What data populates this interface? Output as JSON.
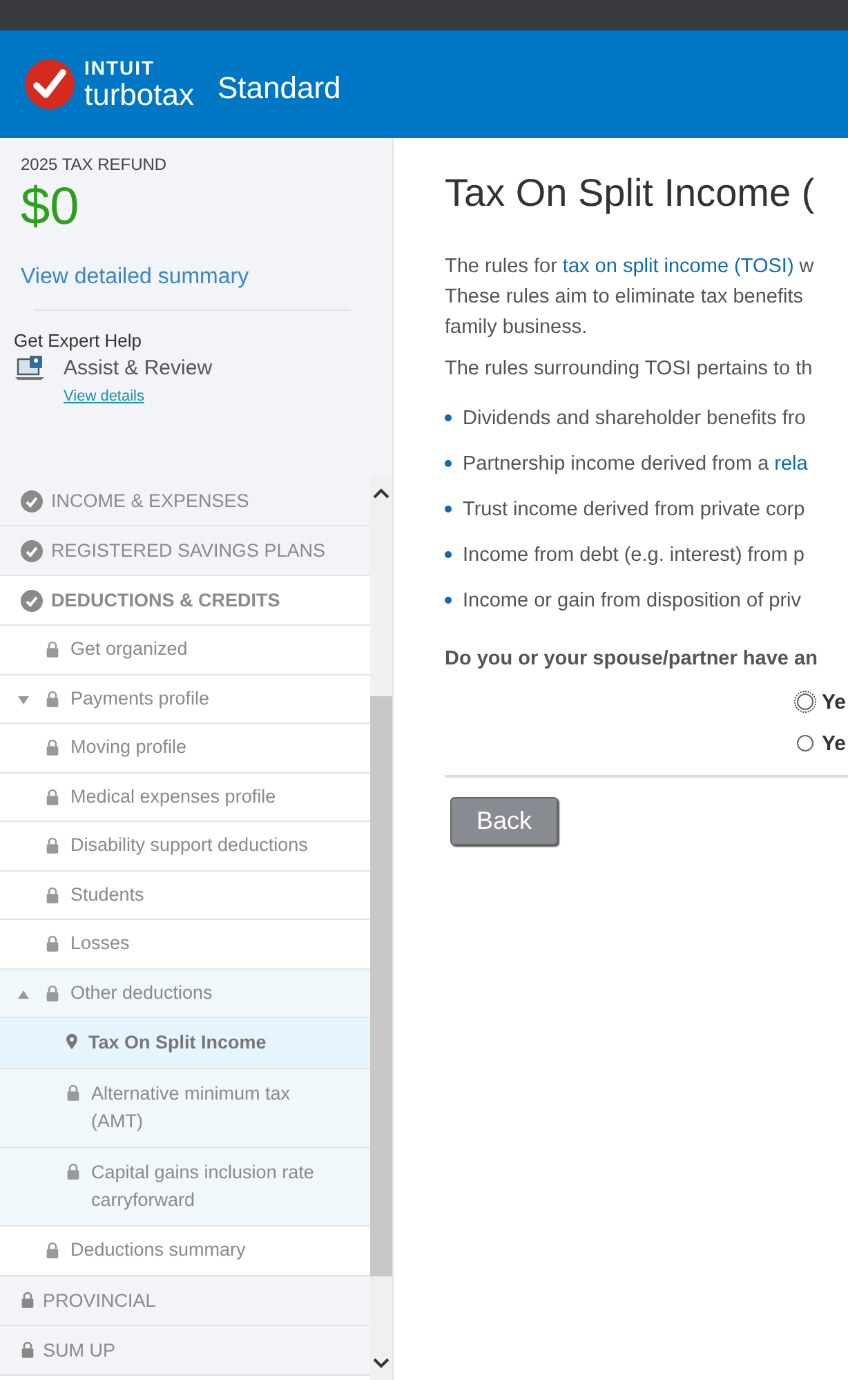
{
  "header": {
    "brand_top": "INTUIT",
    "brand_bottom": "turbotax",
    "edition": "Standard"
  },
  "sidebar": {
    "refund_label": "2025 TAX REFUND",
    "refund_amount": "$0",
    "summary_link": "View detailed summary",
    "help": {
      "title": "Get Expert Help",
      "service": "Assist & Review",
      "link": "View details"
    },
    "nav": [
      {
        "label": "INCOME & EXPENSES",
        "kind": "done",
        "expanded": false
      },
      {
        "label": "REGISTERED SAVINGS PLANS",
        "kind": "done",
        "expanded": false
      },
      {
        "label": "DEDUCTIONS & CREDITS",
        "kind": "done",
        "expanded": true,
        "children": [
          {
            "label": "Get organized",
            "selected": false
          },
          {
            "label": "Payments profile",
            "selected": false,
            "expanded": false
          },
          {
            "label": "Moving profile",
            "selected": false
          },
          {
            "label": "Medical expenses profile",
            "selected": false
          },
          {
            "label": "Disability support deductions",
            "selected": false
          },
          {
            "label": "Students",
            "selected": false
          },
          {
            "label": "Losses",
            "selected": false
          },
          {
            "label": "Other deductions",
            "selected": false,
            "expanded": true,
            "children": [
              {
                "label": "Tax On Split Income",
                "selected": true
              },
              {
                "label": "Alternative minimum tax (AMT)",
                "selected": false
              },
              {
                "label": "Capital gains inclusion rate carryforward",
                "selected": false
              }
            ]
          },
          {
            "label": "Deductions summary",
            "selected": false
          }
        ]
      },
      {
        "label": "PROVINCIAL",
        "kind": "locked",
        "expanded": false
      },
      {
        "label": "SUM UP",
        "kind": "locked",
        "expanded": false
      }
    ]
  },
  "main": {
    "title": "Tax On Split Income (",
    "intro": [
      [
        {
          "text": "The rules for "
        },
        {
          "text": "tax on split income (TOSI)",
          "link": true
        },
        {
          "text": " w"
        }
      ],
      [
        {
          "text": "These rules aim to eliminate tax benefits"
        }
      ],
      [
        {
          "text": "family business."
        }
      ]
    ],
    "lead": "The rules surrounding TOSI pertains to th",
    "bullets": [
      [
        {
          "text": "Dividends and shareholder benefits fro"
        }
      ],
      [
        {
          "text": "Partnership income derived from a "
        },
        {
          "text": "rela",
          "link": true
        }
      ],
      [
        {
          "text": "Trust income derived from private corp"
        }
      ],
      [
        {
          "text": "Income from debt (e.g. interest) from p"
        }
      ],
      [
        {
          "text": "Income or gain from disposition of priv"
        }
      ]
    ],
    "question": "Do you or your spouse/partner have an",
    "options": [
      {
        "label": "Ye",
        "selected": false
      },
      {
        "label": "Ye",
        "selected": false
      }
    ],
    "back_button": "Back"
  }
}
